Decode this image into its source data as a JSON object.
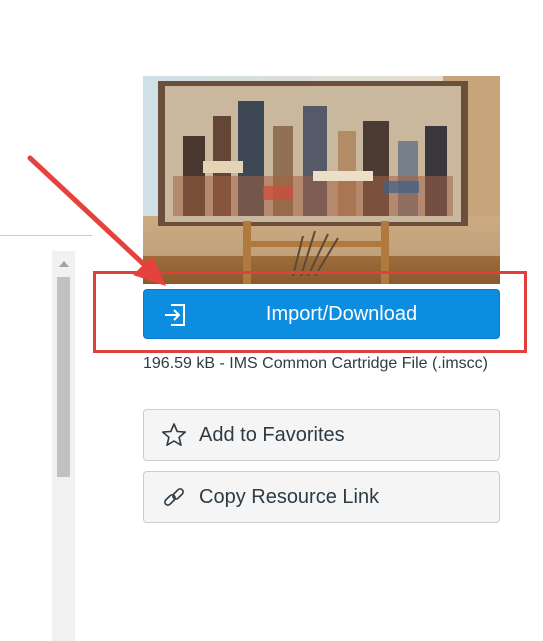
{
  "resource": {
    "import_button_label": "Import/Download",
    "file_info": "196.59 kB - IMS Common Cartridge File (.imscc)",
    "favorite_button_label": "Add to Favorites",
    "copy_link_button_label": "Copy Resource Link"
  },
  "icons": {
    "import": "import-icon",
    "favorite": "star-icon",
    "copy": "link-icon",
    "scroll_up": "chevron-up-icon"
  },
  "colors": {
    "primary": "#0d8de0",
    "highlight": "#e0403c",
    "text": "#2d3b45"
  }
}
